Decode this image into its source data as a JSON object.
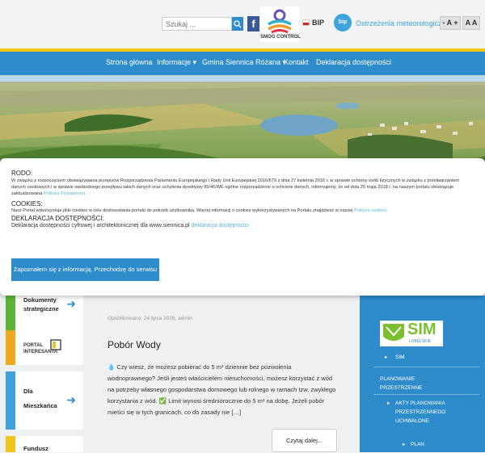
{
  "header": {
    "search_placeholder": "Szukaj ...",
    "facebook_label": "f",
    "smog_label": "SMOG CONTROL",
    "bip_label": "BIP",
    "bip_circle_label": "bip",
    "weather_link": "Ostrzeżenia meteorologiczne",
    "font_increase": "- A +",
    "font_contrast": "A A"
  },
  "nav": {
    "items": [
      {
        "label": "Strona główna"
      },
      {
        "label": "Informacje ▾"
      },
      {
        "label": "Gmina Siennica Różana ▾"
      },
      {
        "label": "Kontakt"
      },
      {
        "label": "Deklaracja dostępności"
      }
    ]
  },
  "cookie_banner": {
    "rodo_heading": "RODO:",
    "rodo_text": "W związku z rozpoczęciem obowiązywania przepisów Rozporządzenia Parlamentu Europejskiego i Rady Unii Europejskiej 2016/679 z dnia 27 kwietnia 2016 r. w sprawie ochrony osób fizycznych w związku z przetwarzaniem danych osobowych i w sprawie swobodnego przepływu takich danych oraz uchylenia dyrektywy 95/46/WE ogólne rozporządzenie o ochronie danych, informujemy, że od dnia 25 maja 2018 r. na naszym portalu obowiązuje zaktualizowana",
    "rodo_link": "Polityka Prywatności.",
    "cookies_heading": "COOKIES:",
    "cookies_text": "Nasz Portal wykorzystuje pliki cookies w celu dostosowania portalu do potrzeb użytkownika. Więcej informacji o cookies wykorzystywanych na Portalu znajdziesz w naszej",
    "cookies_link": "Polityce cookies.",
    "access_heading": "DEKLARACJA DOSTĘPNOŚCI:",
    "access_text": "Deklaracja dostępności cyfrowej i architektonicznej dla www.siennica.pl",
    "access_link": "deklaracja dostępności",
    "accept_button": "Zapoznałem się z informacją. Przechodzę do serwisu"
  },
  "sidebar": {
    "cards": [
      {
        "label": "Dokumenty strategiczne"
      },
      {
        "label": "PORTAL INTERESANTA"
      },
      {
        "label": "Dla Mieszkańca"
      },
      {
        "label": "Fundusz"
      }
    ]
  },
  "post": {
    "meta": "Opublikowano: 24 lipca 2026, admin",
    "title": "Pobór Wody",
    "body": "💧 Czy wiesz, że możesz pobierać do 5 m³ dziennie bez pozwolenia wodnoprawnego? Jeśli jesteś właścicielem nieruchomości, możesz korzystać z wód na potrzeby własnego gospodarstwa domowego lub rolnego w ramach tzw. zwykłego korzystania z wód. ✅ Limit wynosi średniorocznie do 5 m³ na dobę. Jeżeli pobór mieści się w tych granicach, co do zasady nie […]",
    "read_more": "Czytaj dalej..."
  },
  "right_panel": {
    "sim_logo_text": "SIM",
    "sim_logo_sub": "LUBELSKIE",
    "items": [
      {
        "label": "SIM"
      },
      {
        "label": "PLANOWANIE PRZESTRZENNE"
      },
      {
        "label": "AKTY PLANOWANIA PRZESTRZENNEGO UCHWALONE"
      },
      {
        "label": "PLAN"
      }
    ]
  },
  "colors": {
    "primary_blue": "#2f8ccb",
    "nav_accent": "#f0c419",
    "sidebar_green": "#5bb53b",
    "sidebar_orange": "#f0a81e",
    "sidebar_blue": "#3ea3dc",
    "sidebar_yellow": "#f0c419"
  }
}
